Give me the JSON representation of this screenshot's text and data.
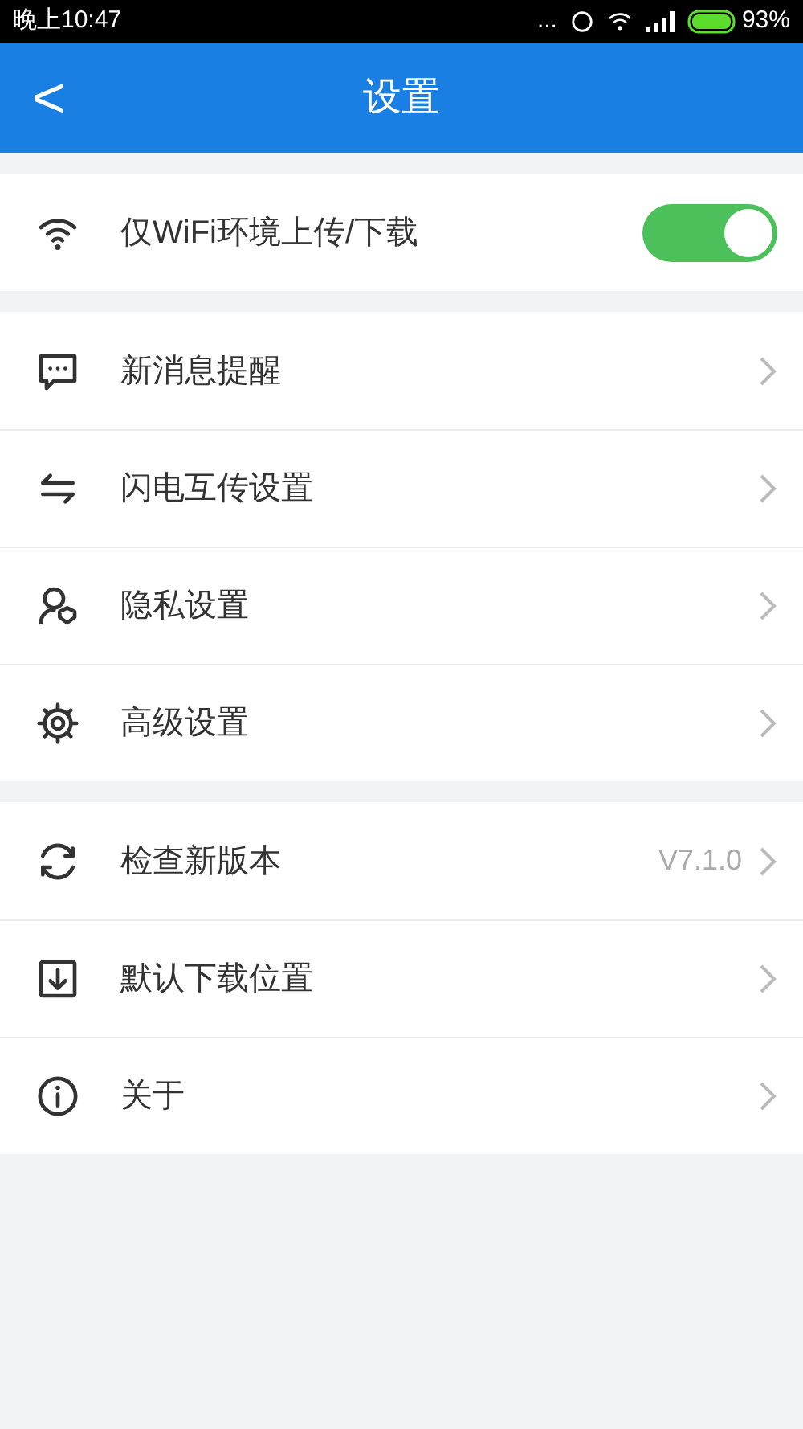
{
  "status_bar": {
    "time": "晚上10:47",
    "more": "...",
    "battery": "93%"
  },
  "header": {
    "back": "<",
    "title": "设置"
  },
  "groups": [
    {
      "rows": [
        {
          "kind": "toggle",
          "label": "仅WiFi环境上传/下载",
          "on": true
        }
      ]
    },
    {
      "rows": [
        {
          "kind": "link",
          "label": "新消息提醒"
        },
        {
          "kind": "link",
          "label": "闪电互传设置"
        },
        {
          "kind": "link",
          "label": "隐私设置"
        },
        {
          "kind": "link",
          "label": "高级设置"
        }
      ]
    },
    {
      "rows": [
        {
          "kind": "link",
          "label": "检查新版本",
          "value": "V7.1.0"
        },
        {
          "kind": "link",
          "label": "默认下载位置"
        },
        {
          "kind": "link",
          "label": "关于"
        }
      ]
    }
  ]
}
